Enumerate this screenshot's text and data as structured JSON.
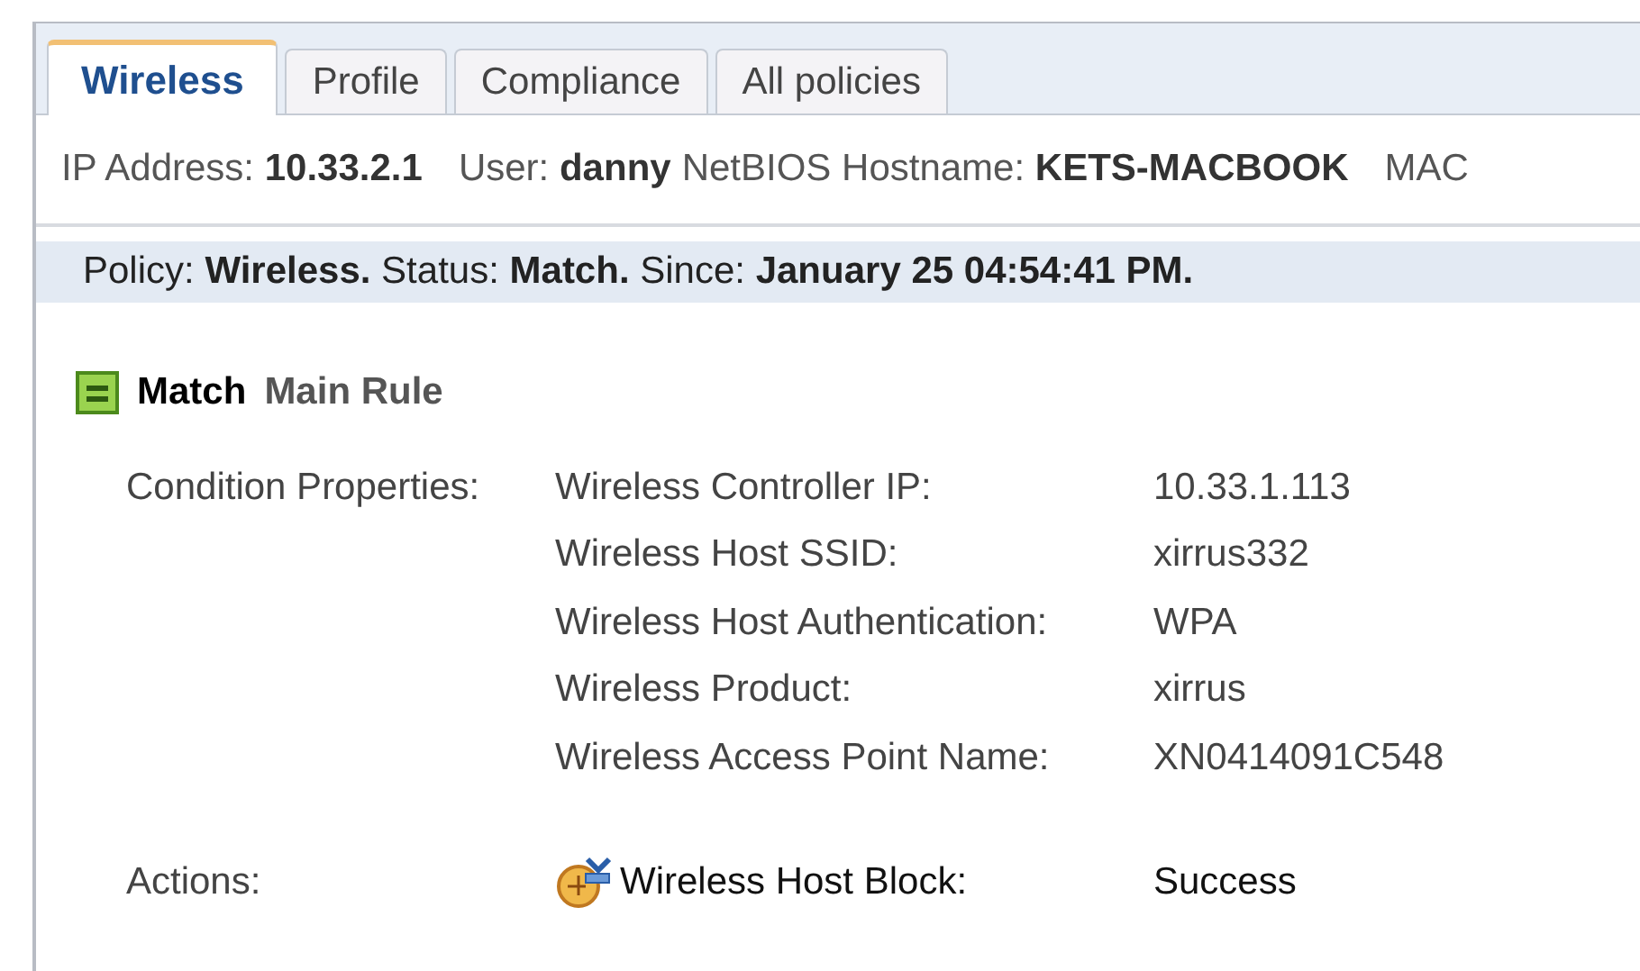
{
  "tabs": [
    {
      "label": "Wireless",
      "selected": true
    },
    {
      "label": "Profile",
      "selected": false
    },
    {
      "label": "Compliance",
      "selected": false
    },
    {
      "label": "All policies",
      "selected": false
    }
  ],
  "info": [
    {
      "label": "IP Address:",
      "value": "10.33.2.1"
    },
    {
      "label": "User:",
      "value": "danny"
    },
    {
      "label": "NetBIOS Hostname:",
      "value": "KETS-MACBOOK"
    },
    {
      "label": "MAC"
    }
  ],
  "policy_line": "Policy: **Wireless.** Status: **Match.** Since: **January 25 04:54:41 PM.**",
  "rule": {
    "result": "Match",
    "name": "Main Rule"
  },
  "conditions": {
    "label": "Condition Properties:",
    "rows": [
      {
        "name": "Wireless Controller IP:",
        "value": "10.33.1.113"
      },
      {
        "name": "Wireless Host SSID:",
        "value": "xirrus332"
      },
      {
        "name": "Wireless Host Authentication:",
        "value": "WPA"
      },
      {
        "name": "Wireless Product:",
        "value": "xirrus"
      },
      {
        "name": "Wireless Access Point Name:",
        "value": "XN0414091C548"
      }
    ]
  },
  "actions": {
    "label": "Actions:",
    "rows": [
      {
        "name": "Wireless Host Block:",
        "value": "Success"
      }
    ]
  }
}
